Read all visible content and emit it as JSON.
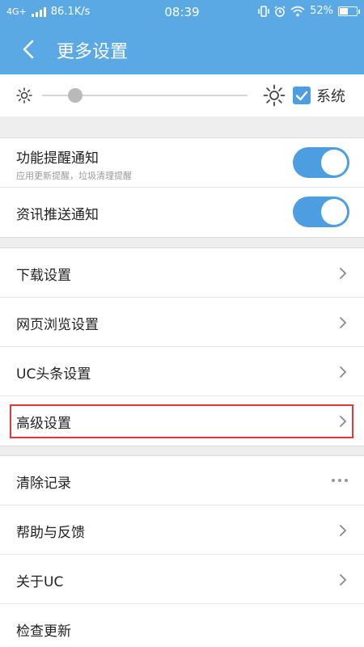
{
  "status_bar": {
    "network": "4G+",
    "speed": "86.1K/s",
    "time": "08:39",
    "battery": "52%",
    "battery_level": 0.52,
    "icons": [
      "signal-icon",
      "vibrate-icon",
      "alarm-icon",
      "wifi-icon",
      "battery-icon"
    ]
  },
  "header": {
    "title": "更多设置"
  },
  "brightness": {
    "level": 0.16,
    "system_label": "系统",
    "system_checked": true
  },
  "notifications": [
    {
      "label": "功能提醒通知",
      "sub": "应用更新提醒，垃圾清理提醒",
      "on": true
    },
    {
      "label": "资讯推送通知",
      "on": true
    }
  ],
  "settings": [
    {
      "label": "下载设置"
    },
    {
      "label": "网页浏览设置"
    },
    {
      "label": "UC头条设置"
    },
    {
      "label": "高级设置",
      "highlighted": true
    }
  ],
  "others": [
    {
      "label": "清除记录",
      "action": "more"
    },
    {
      "label": "帮助与反馈"
    },
    {
      "label": "关于UC"
    },
    {
      "label": "检查更新"
    }
  ],
  "colors": {
    "accent": "#5aa9e4",
    "toggle_on": "#4c9ee0",
    "highlight": "#e23a3a"
  }
}
